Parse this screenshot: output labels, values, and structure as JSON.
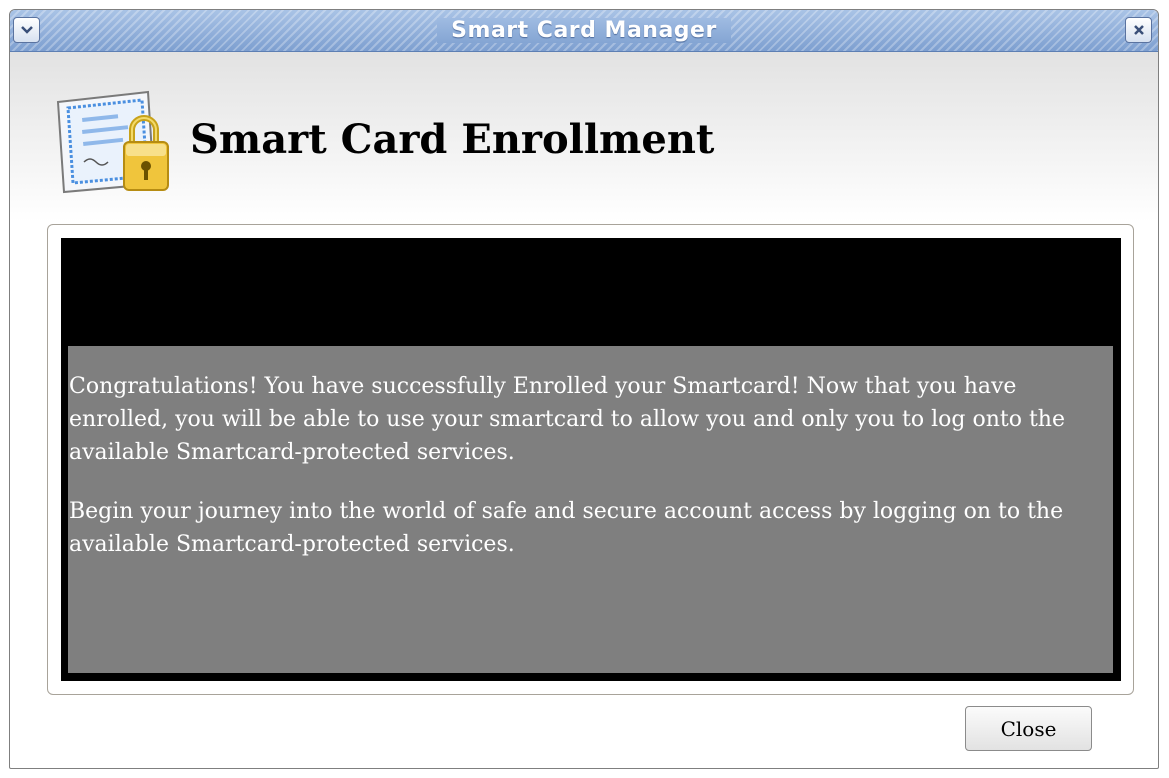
{
  "window": {
    "title": "Smart Card Manager"
  },
  "titlebar": {
    "menu_icon": "chevron-down-icon",
    "close_icon": "close-icon"
  },
  "header": {
    "icon": "certificate-lock-icon",
    "title": "Smart Card Enrollment"
  },
  "message": {
    "paragraphs": [
      "Congratulations! You have successfully Enrolled your Smartcard! Now that you have enrolled, you will be able to use your smartcard to allow you and only you to log onto the available Smartcard-protected services.",
      "Begin your journey into the world of safe and secure account access by logging on to the available Smartcard-protected services."
    ]
  },
  "footer": {
    "close_label": "Close"
  },
  "colors": {
    "titlebar_accent": "#7d9fd0",
    "message_background": "#7f7f7f",
    "browser_background": "#000000"
  }
}
